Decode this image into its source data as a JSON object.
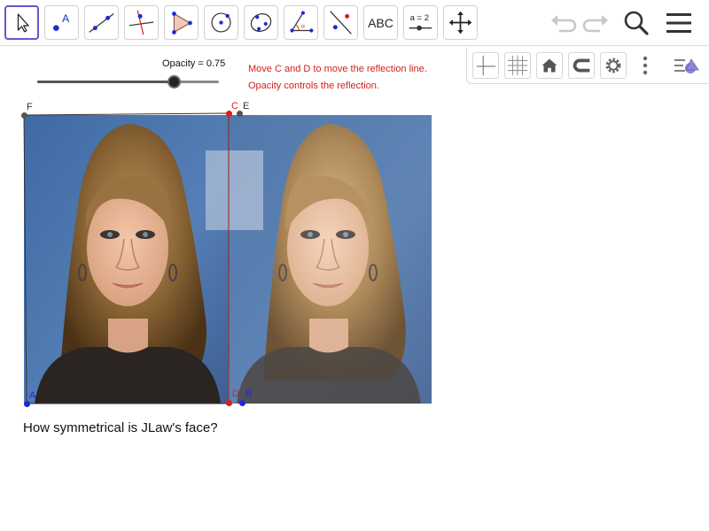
{
  "toolbar": {
    "tools": [
      {
        "name": "move",
        "selected": true
      },
      {
        "name": "point",
        "label": "A"
      },
      {
        "name": "line"
      },
      {
        "name": "perpendicular-line"
      },
      {
        "name": "polygon"
      },
      {
        "name": "circle-center-point"
      },
      {
        "name": "conic-five-points"
      },
      {
        "name": "angle"
      },
      {
        "name": "reflect-about-line"
      },
      {
        "name": "text",
        "label": "ABC"
      },
      {
        "name": "slider",
        "label": "a = 2"
      },
      {
        "name": "move-graphics-view"
      }
    ],
    "right_icons": [
      "undo-icon",
      "redo-icon",
      "search-icon",
      "menu-icon"
    ]
  },
  "stylebar": {
    "icons": [
      "axes-icon",
      "grid-icon",
      "home-icon",
      "point-capturing-icon",
      "settings-icon",
      "more-icon",
      "algebra-view-toggle-icon"
    ]
  },
  "slider": {
    "label": "Opacity = 0.75",
    "value": 0.75,
    "min": 0,
    "max": 1
  },
  "hints": [
    "Move C and D to move the reflection line.",
    "Opacity controls the reflection."
  ],
  "points": {
    "F": {
      "label": "F",
      "color": "#555555"
    },
    "C": {
      "label": "C",
      "color": "#e01b1b"
    },
    "E": {
      "label": "E",
      "color": "#555555"
    },
    "A": {
      "label": "A",
      "color": "#1a2bd6"
    },
    "D": {
      "label": "D",
      "color": "#e01b1b"
    },
    "B": {
      "label": "B",
      "color": "#1a2bd6"
    }
  },
  "question": "How symmetrical is JLaw's face?"
}
